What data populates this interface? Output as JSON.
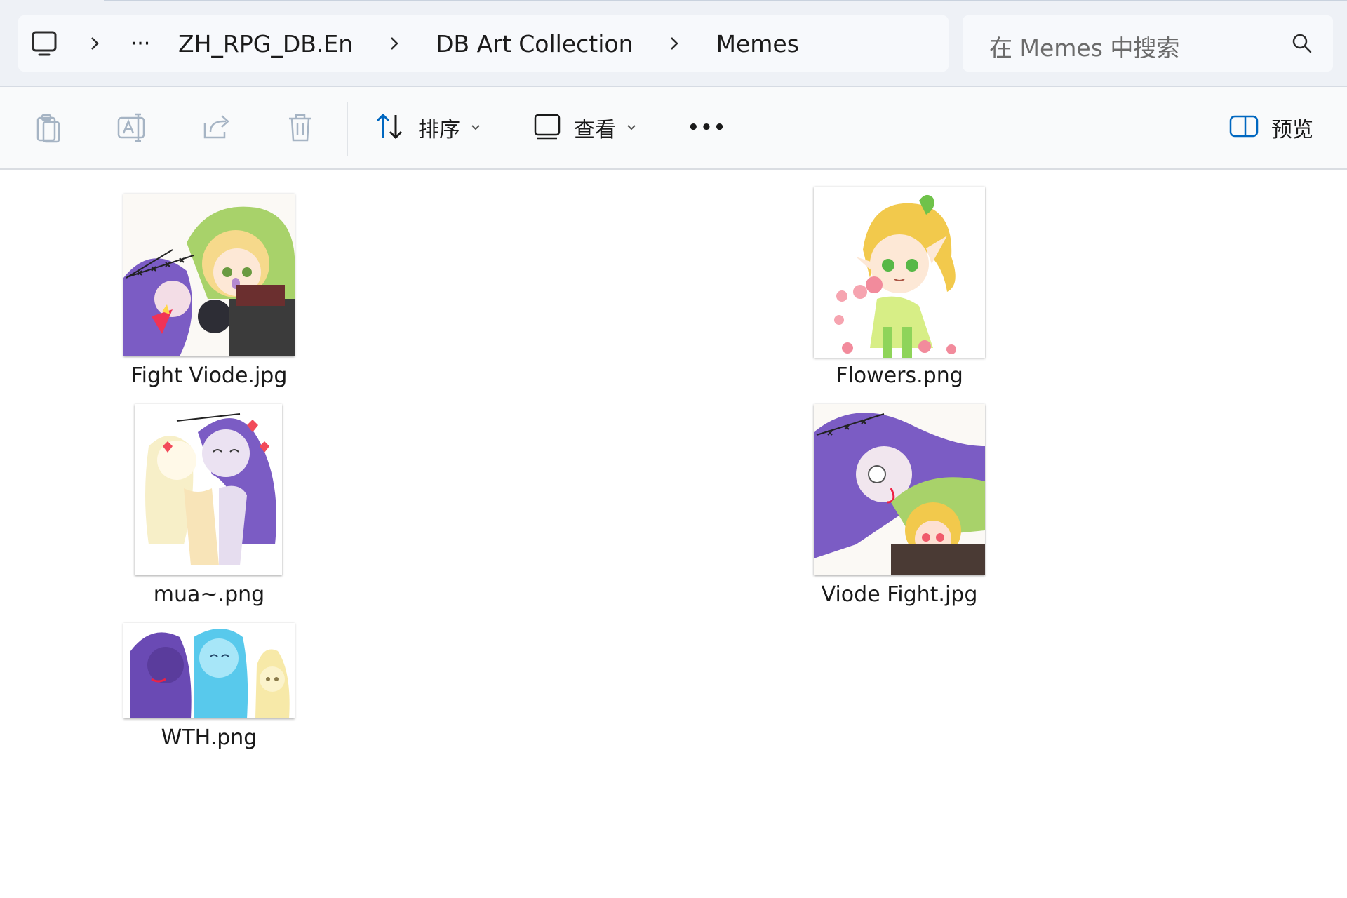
{
  "address_bar": {
    "overflow_label": "···",
    "crumbs": [
      "ZH_RPG_DB.En",
      "DB Art Collection",
      "Memes"
    ]
  },
  "search": {
    "placeholder": "在 Memes 中搜索"
  },
  "command_bar": {
    "sort_label": "排序",
    "view_label": "查看",
    "more_label": "•••",
    "preview_label": "预览"
  },
  "files": [
    {
      "name": "Fight Viode.jpg"
    },
    {
      "name": "Flowers.png"
    },
    {
      "name": "mua~.png"
    },
    {
      "name": "Viode Fight.jpg"
    },
    {
      "name": "WTH.png"
    }
  ],
  "colors": {
    "accent": "#0067c0",
    "disabled_icon": "#a6b4c4",
    "topbar_bg": "#eef1f6",
    "purple_hair": "#7b5cc4",
    "green_hat": "#9cc85a",
    "blonde_hair": "#f2c94c"
  },
  "icons": [
    "this-pc-icon",
    "chevron-right-icon",
    "search-icon",
    "copy-icon",
    "rename-icon",
    "share-icon",
    "delete-icon",
    "sort-icon",
    "view-icon",
    "more-icon",
    "preview-pane-icon",
    "chevron-down-icon"
  ]
}
